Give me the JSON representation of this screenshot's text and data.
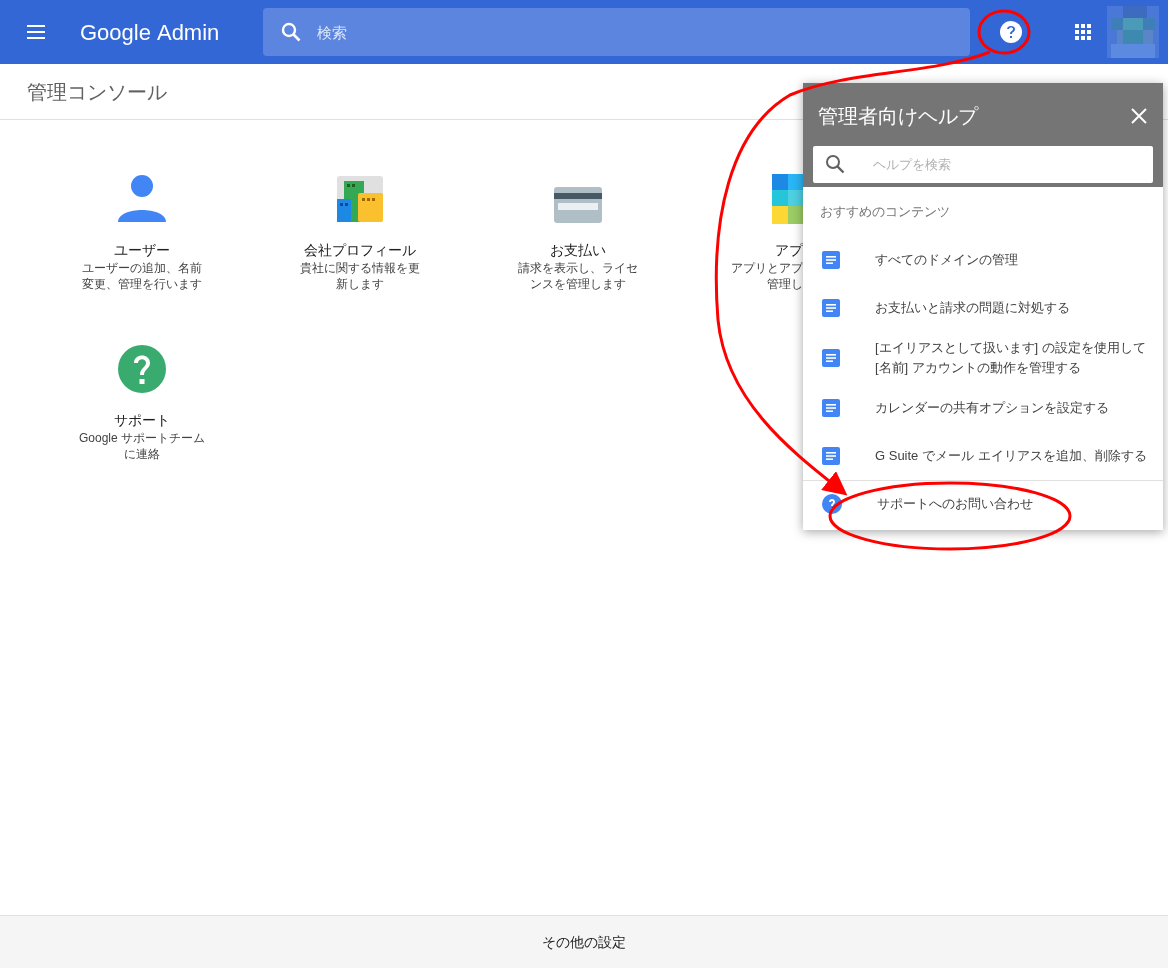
{
  "header": {
    "logo_brand": "Google",
    "logo_product": "Admin",
    "search": {
      "placeholder": "検索"
    }
  },
  "page_title": "管理コンソール",
  "cards": [
    {
      "kind": "user",
      "title": "ユーザー",
      "description": "ユーザーの追加、名前変更、管理を行います"
    },
    {
      "kind": "building",
      "title": "会社プロフィール",
      "description": "貴社に関する情報を更新します"
    },
    {
      "kind": "card",
      "title": "お支払い",
      "description": "請求を表示し、ライセンスを管理します"
    },
    {
      "kind": "apps",
      "title": "アプ",
      "description_lines": [
        "アプリとアプ",
        "管理し"
      ]
    },
    {
      "kind": "support",
      "title": "サポート",
      "description": "Google サポートチームに連絡"
    }
  ],
  "help_panel": {
    "title": "管理者向けヘルプ",
    "search": {
      "placeholder": "ヘルプを検索"
    },
    "section": "おすすめのコンテンツ",
    "articles": [
      {
        "kind": "doc",
        "text": "すべてのドメインの管理"
      },
      {
        "kind": "doc",
        "text": "お支払いと請求の問題に対処する"
      },
      {
        "kind": "doc",
        "text": "[エイリアスとして扱います] の設定を使用して [名前] アカウントの動作を管理する"
      },
      {
        "kind": "doc",
        "text": "カレンダーの共有オプションを設定する"
      },
      {
        "kind": "doc",
        "text": "G Suite でメール エイリアスを追加、削除する"
      },
      {
        "kind": "contact",
        "text": "サポートへのお問い合わせ"
      }
    ]
  },
  "footer": "その他の設定"
}
